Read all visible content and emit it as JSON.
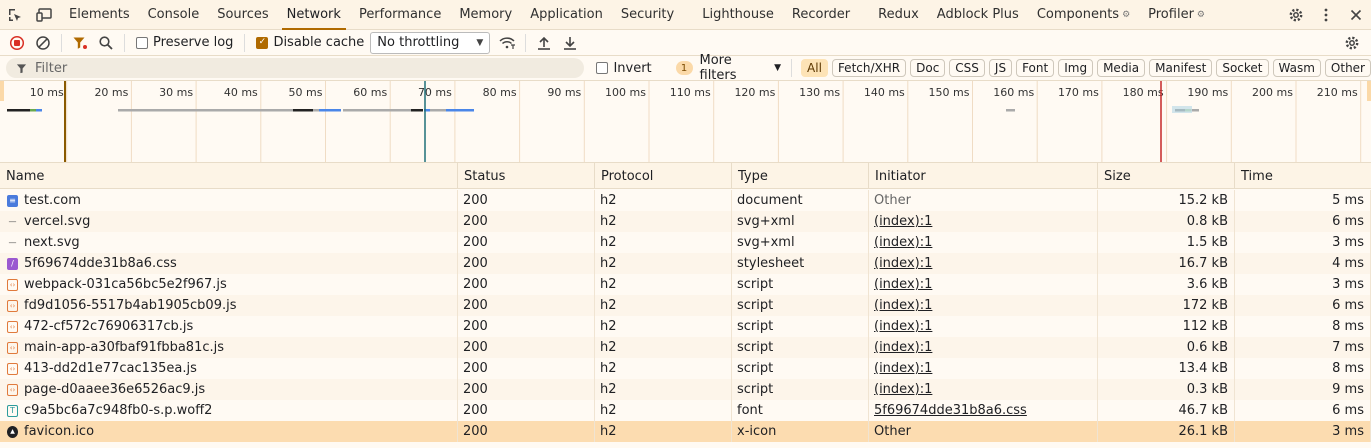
{
  "tabs": [
    {
      "label": "Elements"
    },
    {
      "label": "Console"
    },
    {
      "label": "Sources"
    },
    {
      "label": "Network",
      "active": true
    },
    {
      "label": "Performance"
    },
    {
      "label": "Memory"
    },
    {
      "label": "Application"
    },
    {
      "label": "Security"
    },
    {
      "label": "Lighthouse"
    },
    {
      "label": "Recorder"
    },
    {
      "label": "Redux"
    },
    {
      "label": "Adblock Plus"
    },
    {
      "label": "Components"
    },
    {
      "label": "Profiler"
    }
  ],
  "toolbar": {
    "preserve_log": "Preserve log",
    "disable_cache": "Disable cache",
    "throttling": "No throttling"
  },
  "filterbar": {
    "placeholder": "Filter",
    "invert": "Invert",
    "more_filters_count": "1",
    "more_filters": "More filters",
    "chips": [
      "All",
      "Fetch/XHR",
      "Doc",
      "CSS",
      "JS",
      "Font",
      "Img",
      "Media",
      "Manifest",
      "Socket",
      "Wasm",
      "Other"
    ]
  },
  "overview": {
    "ticks": [
      "10 ms",
      "20 ms",
      "30 ms",
      "40 ms",
      "50 ms",
      "60 ms",
      "70 ms",
      "80 ms",
      "90 ms",
      "100 ms",
      "110 ms",
      "120 ms",
      "130 ms",
      "140 ms",
      "150 ms",
      "160 ms",
      "170 ms",
      "180 ms",
      "190 ms",
      "200 ms",
      "210 ms"
    ]
  },
  "table": {
    "headers": {
      "name": "Name",
      "status": "Status",
      "protocol": "Protocol",
      "type": "Type",
      "initiator": "Initiator",
      "size": "Size",
      "time": "Time"
    },
    "rows": [
      {
        "name": "test.com",
        "icon": "document-icon",
        "icolor": "#4a7bdc",
        "status": "200",
        "protocol": "h2",
        "type": "document",
        "initiator": "Other",
        "initiator_link": false,
        "size": "15.2 kB",
        "time": "5 ms"
      },
      {
        "name": "vercel.svg",
        "icon": "image-icon",
        "icolor": "#555555",
        "status": "200",
        "protocol": "h2",
        "type": "svg+xml",
        "initiator": "(index):1",
        "initiator_link": true,
        "size": "0.8 kB",
        "time": "6 ms"
      },
      {
        "name": "next.svg",
        "icon": "image-icon",
        "icolor": "#555555",
        "status": "200",
        "protocol": "h2",
        "type": "svg+xml",
        "initiator": "(index):1",
        "initiator_link": true,
        "size": "1.5 kB",
        "time": "3 ms"
      },
      {
        "name": "5f69674dde31b8a6.css",
        "icon": "stylesheet-icon",
        "icolor": "#9b59d0",
        "status": "200",
        "protocol": "h2",
        "type": "stylesheet",
        "initiator": "(index):1",
        "initiator_link": true,
        "size": "16.7 kB",
        "time": "4 ms"
      },
      {
        "name": "webpack-031ca56bc5e2f967.js",
        "icon": "script-icon",
        "icolor": "#e07a3c",
        "status": "200",
        "protocol": "h2",
        "type": "script",
        "initiator": "(index):1",
        "initiator_link": true,
        "size": "3.6 kB",
        "time": "3 ms"
      },
      {
        "name": "fd9d1056-5517b4ab1905cb09.js",
        "icon": "script-icon",
        "icolor": "#e07a3c",
        "status": "200",
        "protocol": "h2",
        "type": "script",
        "initiator": "(index):1",
        "initiator_link": true,
        "size": "172 kB",
        "time": "6 ms"
      },
      {
        "name": "472-cf572c76906317cb.js",
        "icon": "script-icon",
        "icolor": "#e07a3c",
        "status": "200",
        "protocol": "h2",
        "type": "script",
        "initiator": "(index):1",
        "initiator_link": true,
        "size": "112 kB",
        "time": "8 ms"
      },
      {
        "name": "main-app-a30fbaf91fbba81c.js",
        "icon": "script-icon",
        "icolor": "#e07a3c",
        "status": "200",
        "protocol": "h2",
        "type": "script",
        "initiator": "(index):1",
        "initiator_link": true,
        "size": "0.6 kB",
        "time": "7 ms"
      },
      {
        "name": "413-dd2d1e77cac135ea.js",
        "icon": "script-icon",
        "icolor": "#e07a3c",
        "status": "200",
        "protocol": "h2",
        "type": "script",
        "initiator": "(index):1",
        "initiator_link": true,
        "size": "13.4 kB",
        "time": "8 ms"
      },
      {
        "name": "page-d0aaee36e6526ac9.js",
        "icon": "script-icon",
        "icolor": "#e07a3c",
        "status": "200",
        "protocol": "h2",
        "type": "script",
        "initiator": "(index):1",
        "initiator_link": true,
        "size": "0.3 kB",
        "time": "9 ms"
      },
      {
        "name": "c9a5bc6a7c948fb0-s.p.woff2",
        "icon": "font-icon",
        "icolor": "#2d9c9c",
        "status": "200",
        "protocol": "h2",
        "type": "font",
        "initiator": "5f69674dde31b8a6.css",
        "initiator_link": true,
        "size": "46.7 kB",
        "time": "6 ms"
      },
      {
        "name": "favicon.ico",
        "icon": "favicon-icon",
        "icolor": "#202124",
        "status": "200",
        "protocol": "h2",
        "type": "x-icon",
        "initiator": "Other",
        "initiator_link": false,
        "size": "26.1 kB",
        "time": "3 ms",
        "selected": true
      }
    ]
  }
}
